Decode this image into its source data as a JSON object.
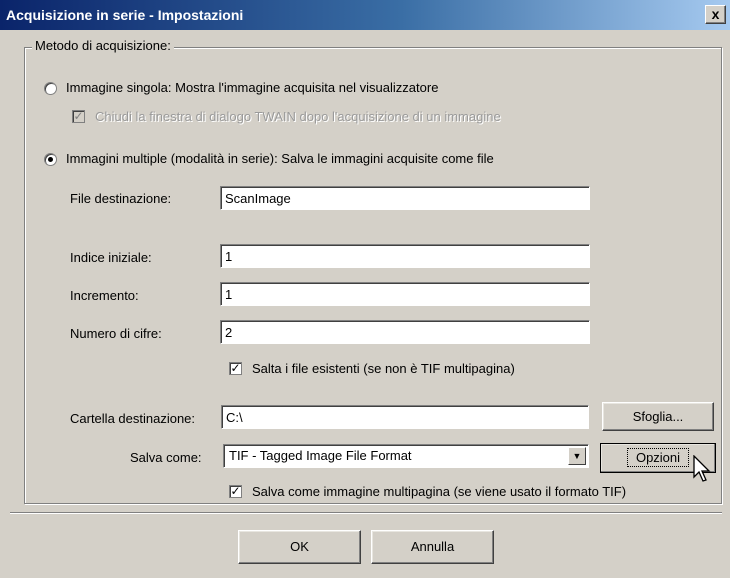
{
  "window": {
    "title": "Acquisizione in serie - Impostazioni",
    "close_label": "x"
  },
  "method_group": {
    "legend": "Metodo di acquisizione:"
  },
  "single": {
    "label": "Immagine singola: Mostra l'immagine acquisita nel visualizzatore",
    "selected": false,
    "close_twain_label": "Chiudi la finestra di dialogo TWAIN dopo l'acquisizione di un immagine",
    "close_twain_checked": true,
    "close_twain_disabled": true
  },
  "multiple": {
    "label": "Immagini multiple (modalità in serie): Salva le immagini acquisite come file",
    "selected": true
  },
  "fields": {
    "dest_file_label": "File destinazione:",
    "dest_file_value": "ScanImage",
    "start_index_label": "Indice iniziale:",
    "start_index_value": "1",
    "increment_label": "Incremento:",
    "increment_value": "1",
    "digits_label": "Numero di cifre:",
    "digits_value": "2",
    "skip_existing_label": "Salta i file esistenti (se non è TIF multipagina)",
    "skip_existing_checked": true,
    "dest_folder_label": "Cartella destinazione:",
    "dest_folder_value": "C:\\",
    "browse_button": "Sfoglia...",
    "save_as_label": "Salva come:",
    "save_as_value": "TIF - Tagged Image File Format",
    "options_button": "Opzioni",
    "multipage_label": "Salva come immagine multipagina (se viene usato il formato TIF)",
    "multipage_checked": true
  },
  "footer": {
    "ok_button": "OK",
    "cancel_button": "Annulla"
  }
}
